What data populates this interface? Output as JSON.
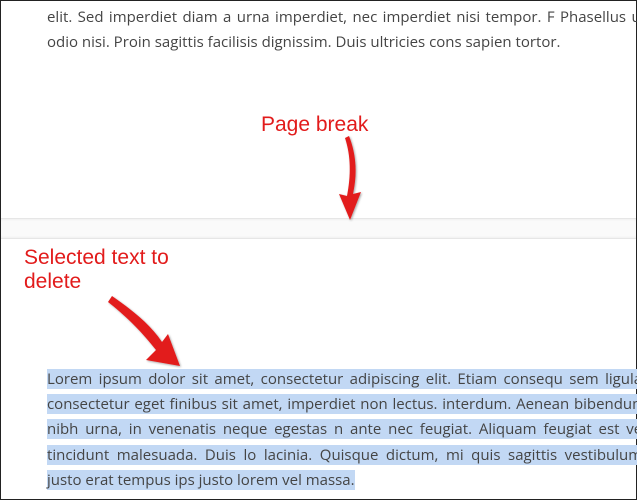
{
  "annotations": {
    "page_break_label": "Page break",
    "selected_text_label": "Selected text to\ndelete"
  },
  "top_paragraph": "elit. Sed imperdiet diam a urna imperdiet, nec imperdiet nisi tempor. F Phasellus ut odio nisi. Proin sagittis facilisis dignissim. Duis ultricies cons sapien tortor.",
  "selected_paragraph": "Lorem ipsum dolor sit amet, consectetur adipiscing elit. Etiam consequ sem ligula, consectetur eget finibus sit amet, imperdiet non lectus. interdum. Aenean bibendum nibh urna, in venenatis neque egestas n ante nec feugiat. Aliquam feugiat est vel tincidunt malesuada. Duis lo lacinia. Quisque dictum, mi quis sagittis vestibulum, justo erat tempus ips justo lorem vel massa.",
  "colors": {
    "annotation": "#e21b1b",
    "selection_bg": "#c2d8f4",
    "text": "#444444"
  }
}
